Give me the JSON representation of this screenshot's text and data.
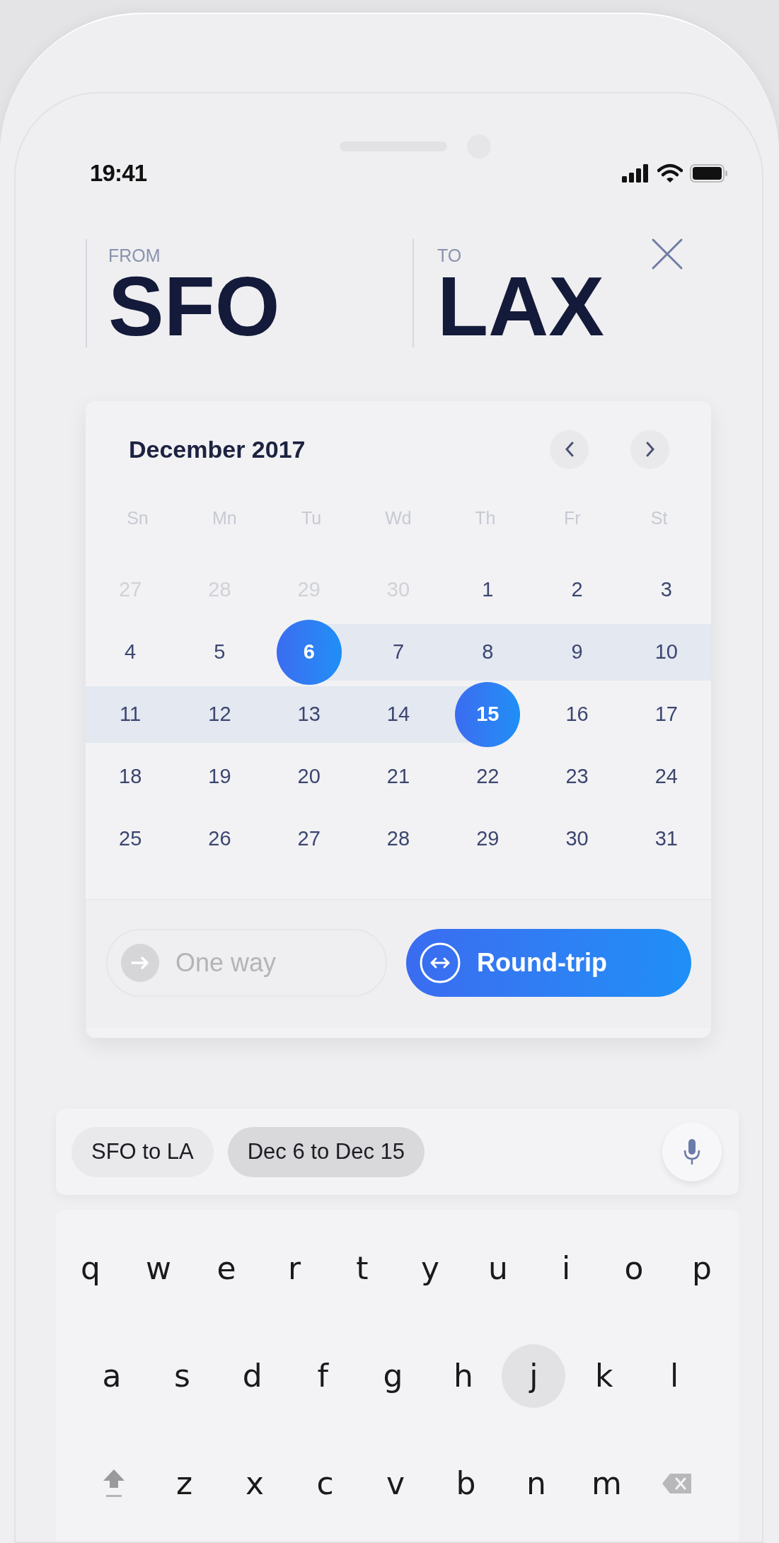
{
  "status_bar": {
    "time": "19:41"
  },
  "route": {
    "from": {
      "label": "FROM",
      "code": "SFO"
    },
    "to": {
      "label": "TO",
      "code": "LAX"
    }
  },
  "calendar": {
    "month": "December 2017",
    "weekdays": [
      "Sn",
      "Mn",
      "Tu",
      "Wd",
      "Th",
      "Fr",
      "St"
    ],
    "days": [
      {
        "label": "27",
        "outside": true,
        "selected": false,
        "in_range": false
      },
      {
        "label": "28",
        "outside": true,
        "selected": false,
        "in_range": false
      },
      {
        "label": "29",
        "outside": true,
        "selected": false,
        "in_range": false
      },
      {
        "label": "30",
        "outside": true,
        "selected": false,
        "in_range": false
      },
      {
        "label": "1",
        "outside": false,
        "selected": false,
        "in_range": false
      },
      {
        "label": "2",
        "outside": false,
        "selected": false,
        "in_range": false
      },
      {
        "label": "3",
        "outside": false,
        "selected": false,
        "in_range": false
      },
      {
        "label": "4",
        "outside": false,
        "selected": false,
        "in_range": false
      },
      {
        "label": "5",
        "outside": false,
        "selected": false,
        "in_range": false
      },
      {
        "label": "6",
        "outside": false,
        "selected": true,
        "in_range": false
      },
      {
        "label": "7",
        "outside": false,
        "selected": false,
        "in_range": true
      },
      {
        "label": "8",
        "outside": false,
        "selected": false,
        "in_range": true
      },
      {
        "label": "9",
        "outside": false,
        "selected": false,
        "in_range": true
      },
      {
        "label": "10",
        "outside": false,
        "selected": false,
        "in_range": true
      },
      {
        "label": "11",
        "outside": false,
        "selected": false,
        "in_range": true
      },
      {
        "label": "12",
        "outside": false,
        "selected": false,
        "in_range": true
      },
      {
        "label": "13",
        "outside": false,
        "selected": false,
        "in_range": true
      },
      {
        "label": "14",
        "outside": false,
        "selected": false,
        "in_range": true
      },
      {
        "label": "15",
        "outside": false,
        "selected": true,
        "in_range": false
      },
      {
        "label": "16",
        "outside": false,
        "selected": false,
        "in_range": false
      },
      {
        "label": "17",
        "outside": false,
        "selected": false,
        "in_range": false
      },
      {
        "label": "18",
        "outside": false,
        "selected": false,
        "in_range": false
      },
      {
        "label": "19",
        "outside": false,
        "selected": false,
        "in_range": false
      },
      {
        "label": "20",
        "outside": false,
        "selected": false,
        "in_range": false
      },
      {
        "label": "21",
        "outside": false,
        "selected": false,
        "in_range": false
      },
      {
        "label": "22",
        "outside": false,
        "selected": false,
        "in_range": false
      },
      {
        "label": "23",
        "outside": false,
        "selected": false,
        "in_range": false
      },
      {
        "label": "24",
        "outside": false,
        "selected": false,
        "in_range": false
      },
      {
        "label": "25",
        "outside": false,
        "selected": false,
        "in_range": false
      },
      {
        "label": "26",
        "outside": false,
        "selected": false,
        "in_range": false
      },
      {
        "label": "27",
        "outside": false,
        "selected": false,
        "in_range": false
      },
      {
        "label": "28",
        "outside": false,
        "selected": false,
        "in_range": false
      },
      {
        "label": "29",
        "outside": false,
        "selected": false,
        "in_range": false
      },
      {
        "label": "30",
        "outside": false,
        "selected": false,
        "in_range": false
      },
      {
        "label": "31",
        "outside": false,
        "selected": false,
        "in_range": false
      }
    ]
  },
  "trip_types": [
    {
      "kind": "one-way",
      "label": "One way",
      "selected": false
    },
    {
      "kind": "round-trip",
      "label": "Round-trip",
      "selected": true
    }
  ],
  "suggestions": [
    {
      "label": "SFO to LA",
      "selected": false
    },
    {
      "label": "Dec 6 to Dec 15",
      "selected": true
    }
  ],
  "keyboard": {
    "rows": [
      [
        {
          "kind": "char",
          "label": "q",
          "pressed": false
        },
        {
          "kind": "char",
          "label": "w",
          "pressed": false
        },
        {
          "kind": "char",
          "label": "e",
          "pressed": false
        },
        {
          "kind": "char",
          "label": "r",
          "pressed": false
        },
        {
          "kind": "char",
          "label": "t",
          "pressed": false
        },
        {
          "kind": "char",
          "label": "y",
          "pressed": false
        },
        {
          "kind": "char",
          "label": "u",
          "pressed": false
        },
        {
          "kind": "char",
          "label": "i",
          "pressed": false
        },
        {
          "kind": "char",
          "label": "o",
          "pressed": false
        },
        {
          "kind": "char",
          "label": "p",
          "pressed": false
        }
      ],
      [
        {
          "kind": "char",
          "label": "a",
          "pressed": false
        },
        {
          "kind": "char",
          "label": "s",
          "pressed": false
        },
        {
          "kind": "char",
          "label": "d",
          "pressed": false
        },
        {
          "kind": "char",
          "label": "f",
          "pressed": false
        },
        {
          "kind": "char",
          "label": "g",
          "pressed": false
        },
        {
          "kind": "char",
          "label": "h",
          "pressed": false
        },
        {
          "kind": "char",
          "label": "j",
          "pressed": true
        },
        {
          "kind": "char",
          "label": "k",
          "pressed": false
        },
        {
          "kind": "char",
          "label": "l",
          "pressed": false
        }
      ],
      [
        {
          "kind": "shift",
          "pressed": false
        },
        {
          "kind": "char",
          "label": "z",
          "pressed": false
        },
        {
          "kind": "char",
          "label": "x",
          "pressed": false
        },
        {
          "kind": "char",
          "label": "c",
          "pressed": false
        },
        {
          "kind": "char",
          "label": "v",
          "pressed": false
        },
        {
          "kind": "char",
          "label": "b",
          "pressed": false
        },
        {
          "kind": "char",
          "label": "n",
          "pressed": false
        },
        {
          "kind": "char",
          "label": "m",
          "pressed": false
        },
        {
          "kind": "backspace",
          "pressed": false
        }
      ]
    ]
  }
}
